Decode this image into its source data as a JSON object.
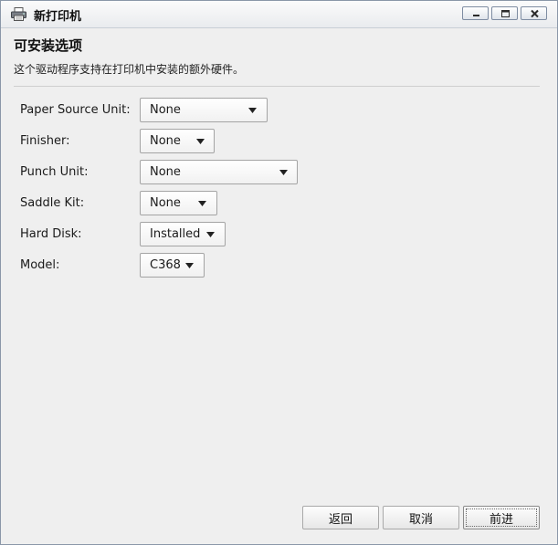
{
  "window": {
    "title": "新打印机",
    "icons": {
      "app": "printer-icon",
      "minimize": "minimize-icon",
      "maximize": "maximize-icon",
      "close": "close-icon"
    }
  },
  "page": {
    "title": "可安装选项",
    "description": "这个驱动程序支持在打印机中安装的额外硬件。"
  },
  "options": [
    {
      "label": "Paper Source Unit:",
      "value": "None"
    },
    {
      "label": "Finisher:",
      "value": "None"
    },
    {
      "label": "Punch Unit:",
      "value": "None"
    },
    {
      "label": "Saddle Kit:",
      "value": "None"
    },
    {
      "label": "Hard Disk:",
      "value": "Installed"
    },
    {
      "label": "Model:",
      "value": "C368"
    }
  ],
  "buttons": {
    "back": "返回",
    "cancel": "取消",
    "forward": "前进"
  },
  "colors": {
    "window_border": "#8a97a8",
    "background": "#efefef"
  }
}
